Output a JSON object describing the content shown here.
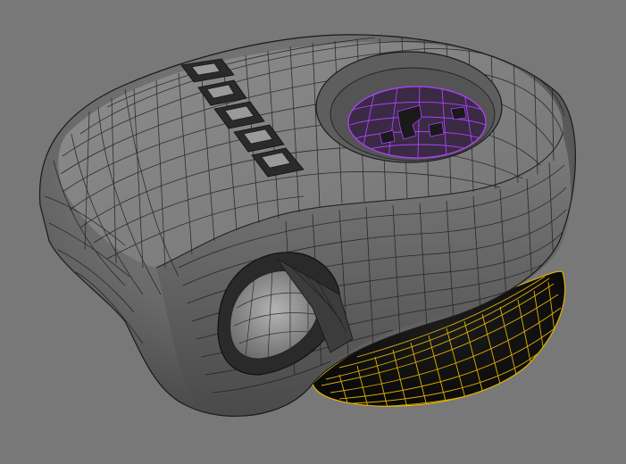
{
  "viewport": {
    "background": "#787878",
    "shading": "smooth-wireframe"
  },
  "model": {
    "body_color": "#6e6e6e",
    "wire_color": "#1e1e1e",
    "top_selection_wire_color": "#b040ff",
    "bottom_selection_wire_color": "#e0b000",
    "letter_slots": 5
  }
}
